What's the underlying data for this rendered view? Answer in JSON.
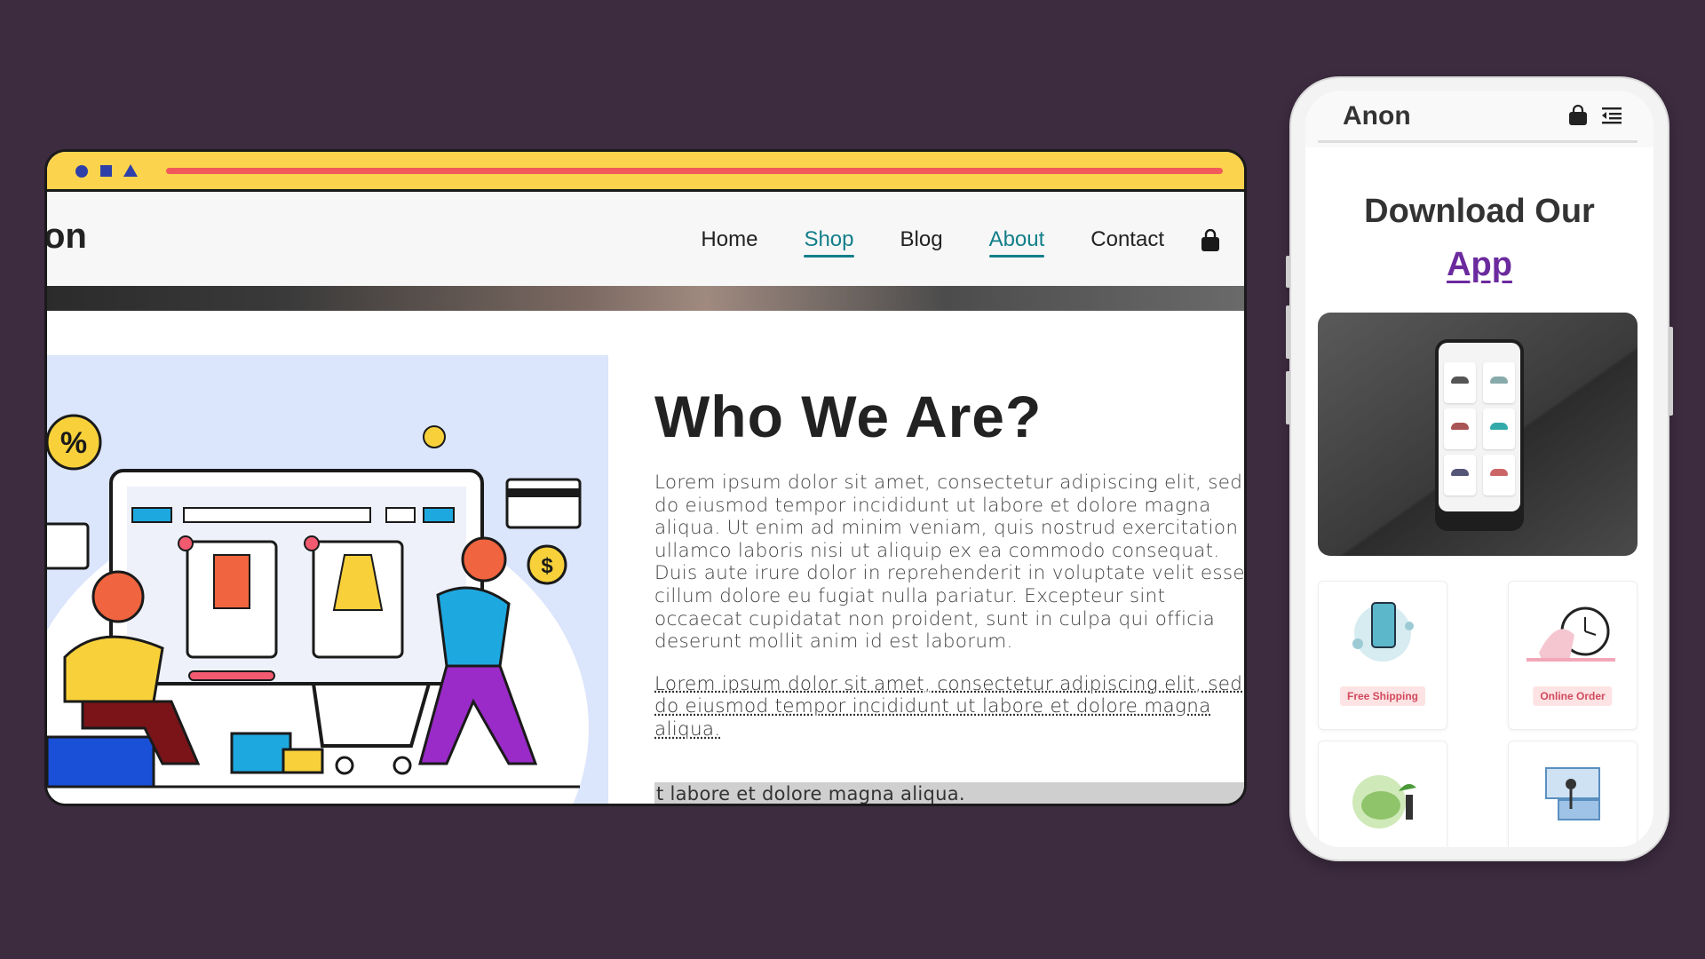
{
  "desktop": {
    "logo_fragment": "on",
    "nav": [
      {
        "label": "Home",
        "active": false
      },
      {
        "label": "Shop",
        "active": true
      },
      {
        "label": "Blog",
        "active": false
      },
      {
        "label": "About",
        "active": true
      },
      {
        "label": "Contact",
        "active": false
      }
    ],
    "heading": "Who We Are?",
    "paragraph": "Lorem ipsum dolor sit amet, consectetur adipiscing elit, sed do eiusmod tempor incididunt ut labore et dolore magna aliqua. Ut enim ad minim veniam, quis nostrud exercitation ullamco laboris nisi ut aliquip ex ea commodo consequat. Duis aute irure dolor in reprehenderit in voluptate velit esse cillum dolore eu fugiat nulla pariatur. Excepteur sint occaecat cupidatat non proident, sunt in culpa qui officia deserunt mollit anim id est laborum.",
    "link_paragraph": "Lorem ipsum dolor sit amet, consectetur adipiscing elit, sed do eiusmod tempor incididunt ut labore et dolore magna aliqua.",
    "highlight_text": "t labore et dolore magna aliqua.",
    "illustration": {
      "percent_badge": "%",
      "dollar": "$"
    }
  },
  "mobile": {
    "logo": "Anon",
    "title_line1": "Download Our",
    "title_link": "App",
    "cards": [
      {
        "label": "Free Shipping"
      },
      {
        "label": "Online Order"
      },
      {
        "label": ""
      },
      {
        "label": ""
      }
    ]
  },
  "colors": {
    "background": "#3d2b40",
    "browser_bar": "#fbd34d",
    "url_line": "#f05a5a",
    "nav_active": "#137f8a",
    "app_link": "#6b2a9e"
  }
}
